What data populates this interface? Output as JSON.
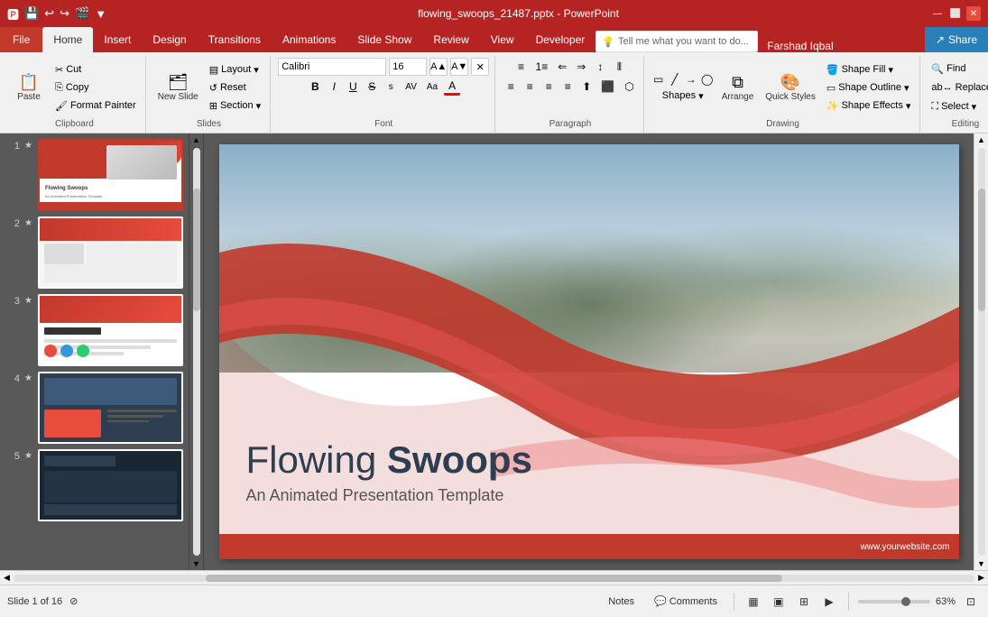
{
  "titleBar": {
    "title": "flowing_swoops_21487.pptx - PowerPoint",
    "quickAccessIcons": [
      "💾",
      "↩",
      "↪",
      "🎬",
      "▼"
    ],
    "windowControls": [
      "—",
      "⬜",
      "✕"
    ]
  },
  "ribbonTabs": {
    "file": "File",
    "tabs": [
      "Home",
      "Insert",
      "Design",
      "Transitions",
      "Animations",
      "Slide Show",
      "Review",
      "View",
      "Developer"
    ],
    "activeTab": "Home",
    "tellMe": "Tell me what you want to do...",
    "user": "Farshad Iqbal",
    "share": "Share"
  },
  "ribbon": {
    "groups": {
      "clipboard": {
        "label": "Clipboard",
        "paste": "Paste",
        "cut": "Cut",
        "copy": "Copy",
        "formatPainter": "Format Painter"
      },
      "slides": {
        "label": "Slides",
        "newSlide": "New Slide",
        "layout": "Layout",
        "reset": "Reset",
        "section": "Section"
      },
      "font": {
        "label": "Font",
        "fontName": "Calibri",
        "fontSize": "16",
        "bold": "B",
        "italic": "I",
        "underline": "U",
        "strikethrough": "S",
        "shadow": "s",
        "charSpacing": "AV",
        "changeCase": "Aa",
        "fontColor": "A"
      },
      "paragraph": {
        "label": "Paragraph",
        "bullets": "≡",
        "numbering": "1≡",
        "decreaseIndent": "⇐",
        "increaseIndent": "⇒",
        "lineSpacing": "↕",
        "alignLeft": "≡",
        "alignCenter": "≡",
        "alignRight": "≡",
        "justify": "≡",
        "columns": "⫴",
        "textDirection": "⬆",
        "alignText": "⬛",
        "smartArt": "⬡"
      },
      "drawing": {
        "label": "Drawing",
        "shapes": "Shapes",
        "arrange": "Arrange",
        "quickStyles": "Quick Styles",
        "shapeFill": "Shape Fill",
        "shapeOutline": "Shape Outline",
        "shapeEffects": "Shape Effects"
      },
      "editing": {
        "label": "Editing",
        "find": "Find",
        "replace": "Replace",
        "select": "Select"
      }
    }
  },
  "slidePanel": {
    "slides": [
      {
        "num": "1",
        "star": "★",
        "active": true
      },
      {
        "num": "2",
        "star": "★",
        "active": false
      },
      {
        "num": "3",
        "star": "★",
        "active": false
      },
      {
        "num": "4",
        "star": "★",
        "active": false
      },
      {
        "num": "5",
        "star": "★",
        "active": false
      }
    ]
  },
  "mainSlide": {
    "title": "Flowing",
    "titleBold": "Swoops",
    "subtitle": "An Animated Presentation Template",
    "footerUrl": "www.yourwebsite.com"
  },
  "statusBar": {
    "slideInfo": "Slide 1 of 16",
    "notes": "Notes",
    "comments": "Comments",
    "zoom": "63%",
    "viewButtons": [
      "▦",
      "▣",
      "⊞",
      "▤"
    ]
  }
}
